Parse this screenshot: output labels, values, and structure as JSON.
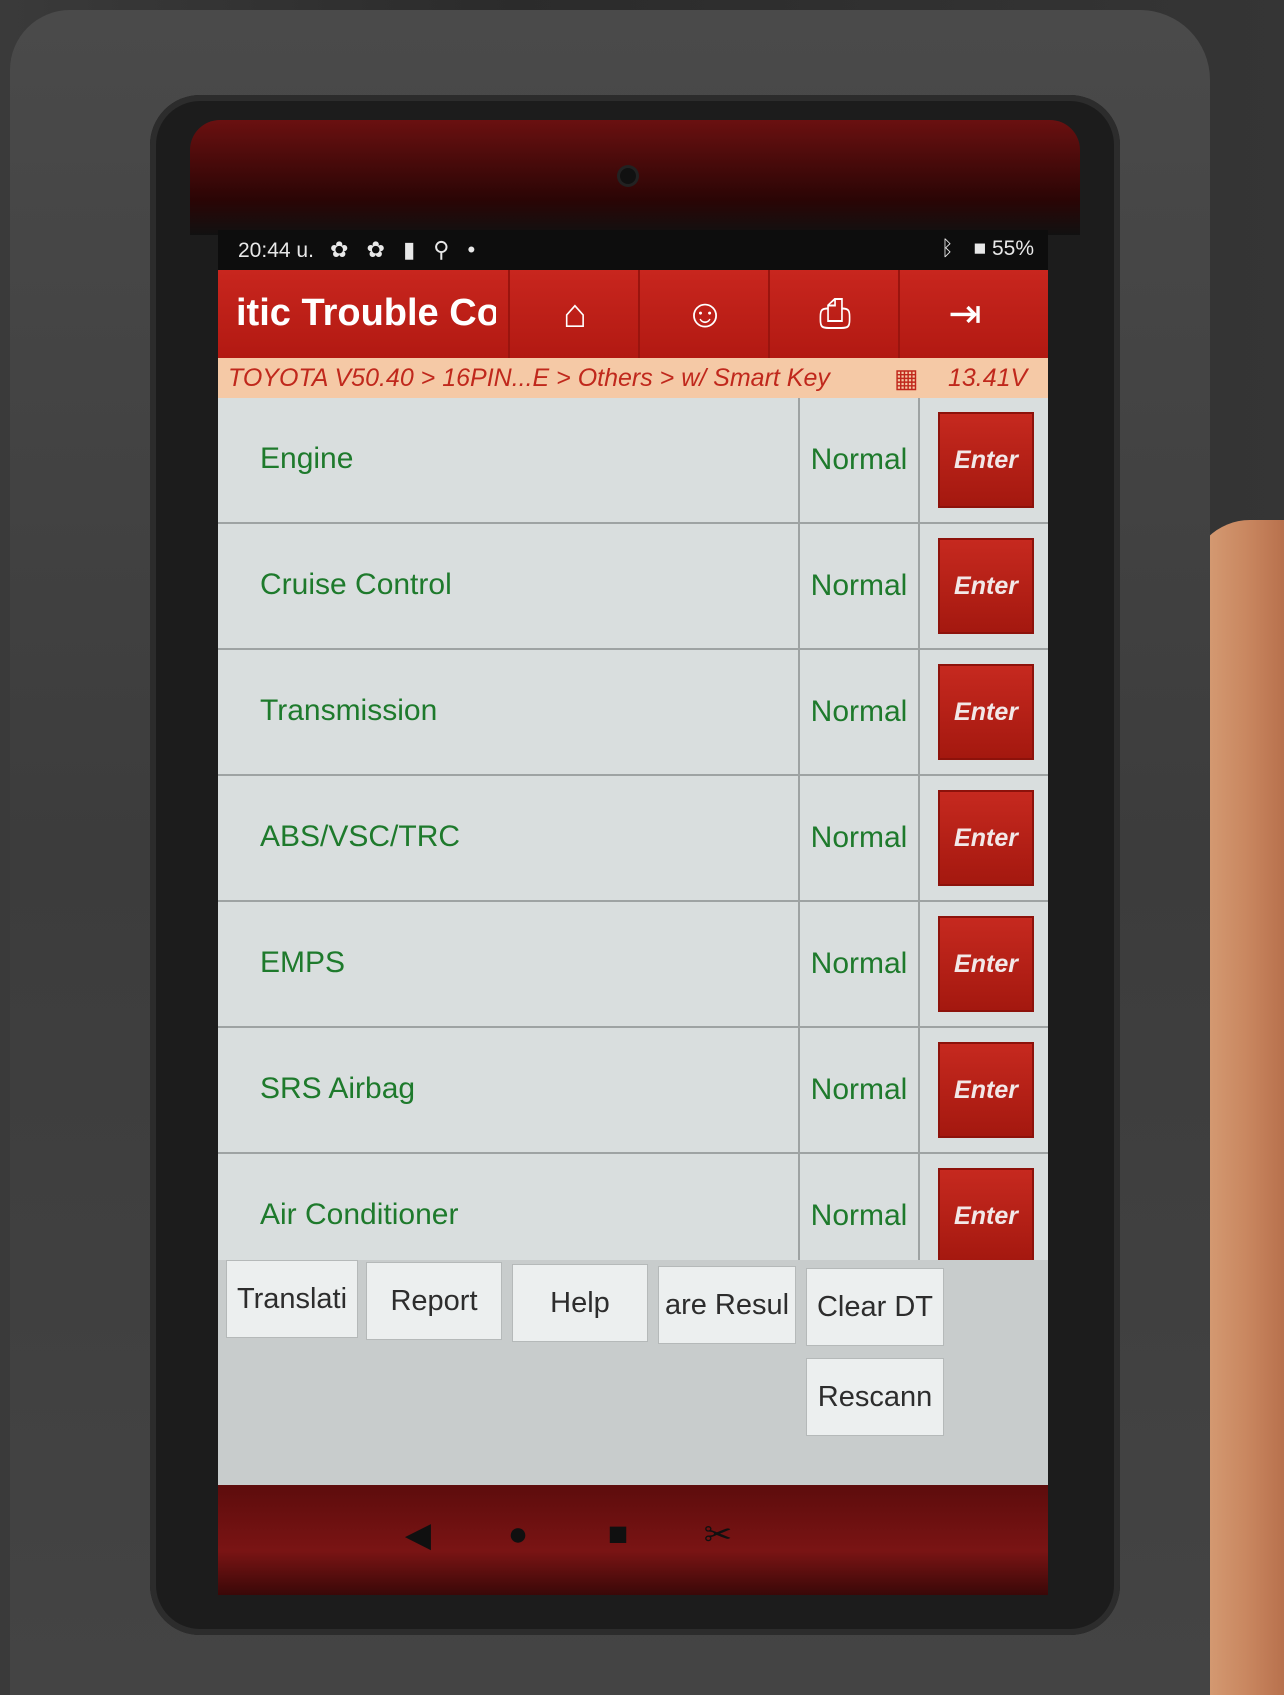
{
  "status_bar": {
    "time": "20:44 u.",
    "icons": "✿ ✿ ▮ ⚲ •",
    "bluetooth": "ᛒ",
    "battery": "■ 55%"
  },
  "header": {
    "title": "itic Trouble Co",
    "home_icon": "⌂",
    "support_icon": "☺",
    "print_icon": "⎙",
    "exit_icon": "⇥"
  },
  "breadcrumb": {
    "path": "TOYOTA V50.40 > 16PIN...E > Others > w/ Smart Key",
    "calendar_icon": "▦",
    "voltage": "13.41V"
  },
  "systems": [
    {
      "name": "Engine",
      "status": "Normal",
      "action": "Enter"
    },
    {
      "name": "Cruise Control",
      "status": "Normal",
      "action": "Enter"
    },
    {
      "name": "Transmission",
      "status": "Normal",
      "action": "Enter"
    },
    {
      "name": "ABS/VSC/TRC",
      "status": "Normal",
      "action": "Enter"
    },
    {
      "name": "EMPS",
      "status": "Normal",
      "action": "Enter"
    },
    {
      "name": "SRS Airbag",
      "status": "Normal",
      "action": "Enter"
    },
    {
      "name": "Air Conditioner",
      "status": "Normal",
      "action": "Enter"
    }
  ],
  "actions": {
    "translate": "Translati",
    "report": "Report",
    "help": "Help",
    "compare": "are Resul",
    "clear_dtc": "Clear DT",
    "rescan": "Rescann"
  },
  "nav": {
    "back": "◀",
    "home": "●",
    "recents": "■",
    "screenshot": "✂"
  }
}
